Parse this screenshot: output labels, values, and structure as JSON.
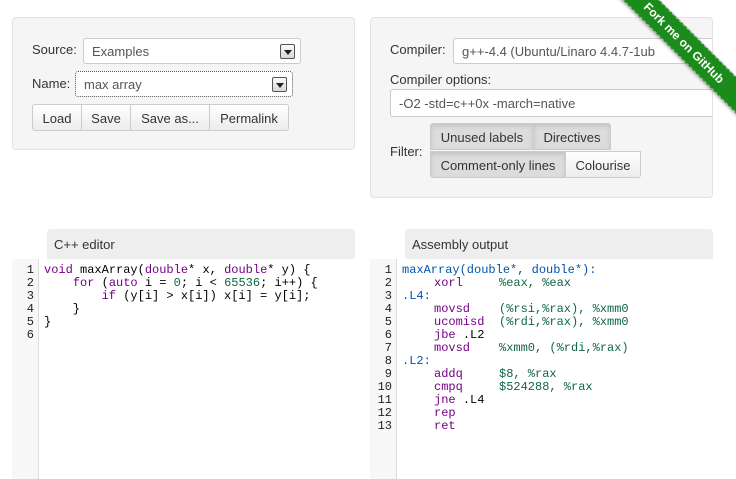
{
  "source": {
    "label": "Source:",
    "value": "Examples"
  },
  "name": {
    "label": "Name:",
    "value": "max array"
  },
  "actions": {
    "load": "Load",
    "save": "Save",
    "save_as": "Save as...",
    "permalink": "Permalink"
  },
  "compiler": {
    "label": "Compiler:",
    "value": "g++-4.4 (Ubuntu/Linaro 4.4.7-1ub"
  },
  "compiler_options": {
    "label": "Compiler options:",
    "value": "-O2 -std=c++0x -march=native"
  },
  "filter": {
    "label": "Filter:",
    "unused_labels": "Unused labels",
    "directives": "Directives",
    "comment_only": "Comment-only lines",
    "colourise": "Colourise"
  },
  "ribbon": {
    "text": "Fork me on GitHub"
  },
  "editor": {
    "tab": "C++ editor",
    "line_numbers": [
      "1",
      "2",
      "3",
      "4",
      "5",
      "6"
    ]
  },
  "asm": {
    "tab": "Assembly output",
    "line_numbers": [
      "1",
      "2",
      "3",
      "4",
      "5",
      "6",
      "7",
      "8",
      "9",
      "10",
      "11",
      "12",
      "13"
    ]
  },
  "code": {
    "l1": {
      "a": "void",
      "b": " maxArray(",
      "c": "double",
      "d": "* x, ",
      "e": "double",
      "f": "* y) {"
    },
    "l2": {
      "a": "    ",
      "b": "for",
      "c": " (",
      "d": "auto",
      "e": " i = ",
      "f": "0",
      "g": "; i < ",
      "h": "65536",
      "i": "; i++) {"
    },
    "l3": {
      "a": "        ",
      "b": "if",
      "c": " (y[i] > x[i]) x[i] = y[i];"
    },
    "l4": "    }",
    "l5": "}",
    "l6": ""
  },
  "asmcode": {
    "l1": "maxArray(double*, double*):",
    "l2": {
      "ins": "xorl",
      "args": "%eax, %eax"
    },
    "l3": ".L4:",
    "l4": {
      "ins": "movsd",
      "args": "(%rsi,%rax), %xmm0"
    },
    "l5": {
      "ins": "ucomisd",
      "args": "(%rdi,%rax), %xmm0"
    },
    "l6": {
      "ins": "jbe",
      "args": ".L2"
    },
    "l7": {
      "ins": "movsd",
      "args": "%xmm0, (%rdi,%rax)"
    },
    "l8": ".L2:",
    "l9": {
      "ins": "addq",
      "args": "$8, %rax"
    },
    "l10": {
      "ins": "cmpq",
      "args": "$524288, %rax"
    },
    "l11": {
      "ins": "jne",
      "args": ".L4"
    },
    "l12": {
      "ins": "rep",
      "args": ""
    },
    "l13": {
      "ins": "ret",
      "args": ""
    }
  }
}
